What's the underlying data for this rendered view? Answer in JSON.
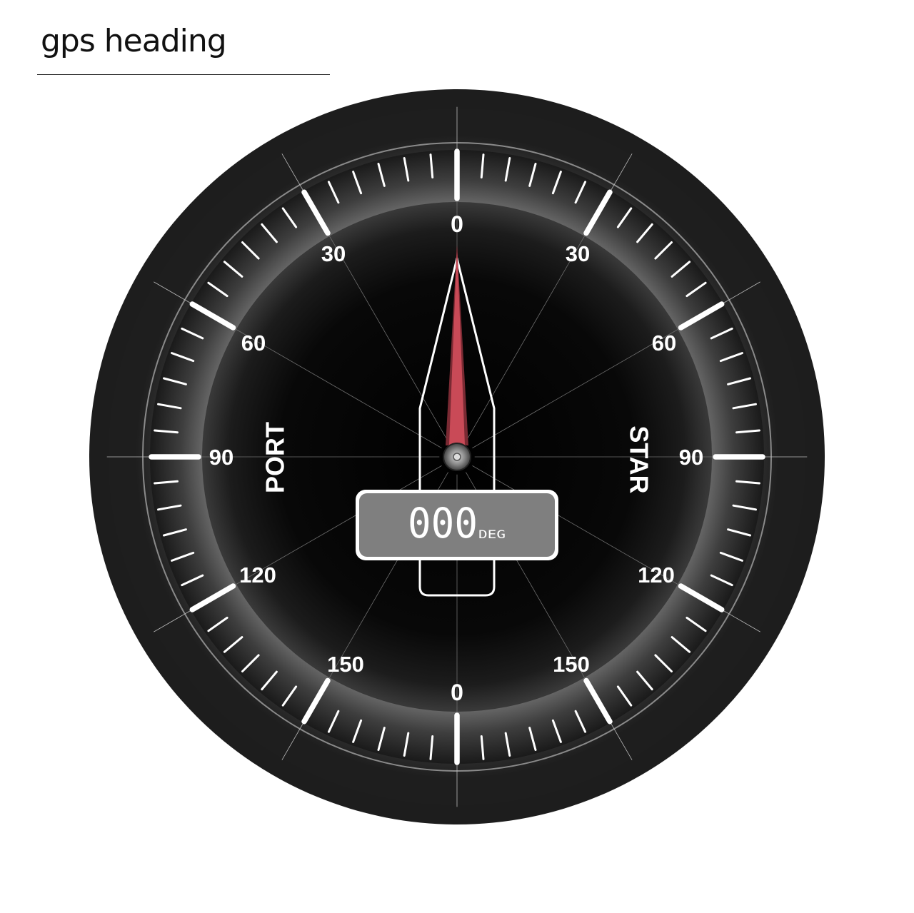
{
  "title": "gps heading",
  "gauge": {
    "top_label": "0",
    "bottom_label": "0",
    "port_label": "PORT",
    "star_label": "STAR",
    "scale_labels": [
      "30",
      "60",
      "90",
      "120",
      "150"
    ],
    "heading_value": "000",
    "heading_unit": "DEG",
    "needle_color": "#c94a57"
  }
}
